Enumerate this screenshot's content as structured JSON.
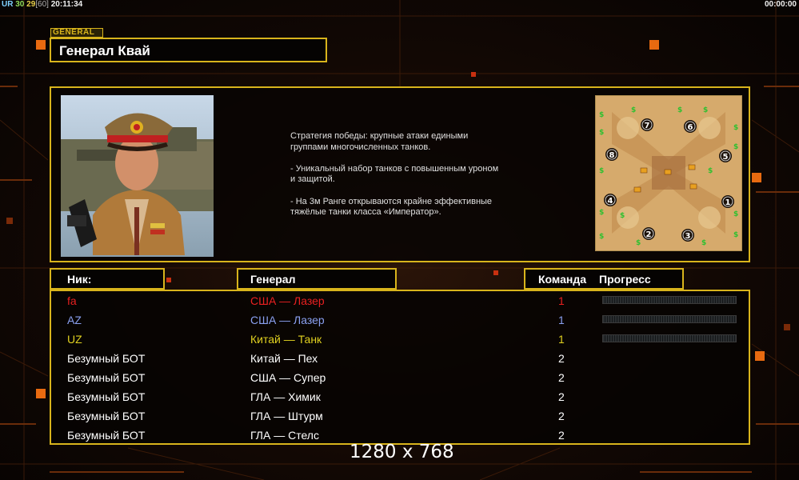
{
  "topbar": {
    "ur": "UR",
    "n1": "30",
    "n2": "29",
    "fps": "[60]",
    "clock": "20:11:34",
    "timer": "00:00:00"
  },
  "general_tag": "GENERAL",
  "general_name": "Генерал Квай",
  "description": "Стратегия победы: крупные атаки едиными\n группами многочисленных танков.\n\n- Уникальный набор танков с повышенным уроном\n и защитой.\n\n- На 3м Ранге открываются крайне эффективные\n тяжёлые танки класса «Император».",
  "minimap": {
    "spawn_numbers": [
      "7",
      "6",
      "8",
      "5",
      "4",
      "1",
      "2",
      "3"
    ]
  },
  "headers": {
    "nick": "Ник:",
    "general": "Генерал",
    "team": "Команда",
    "progress": "Прогресс"
  },
  "players": [
    {
      "nick": "fa",
      "general": "США — Лазер",
      "team": "1",
      "color": "#e82020",
      "progress": 0
    },
    {
      "nick": "AZ",
      "general": "США — Лазер",
      "team": "1",
      "color": "#8aa0f0",
      "progress": 0
    },
    {
      "nick": "UZ",
      "general": "Китай — Танк",
      "team": "1",
      "color": "#e0d020",
      "progress": 0
    },
    {
      "nick": "Безумный БОТ",
      "general": "Китай — Пех",
      "team": "2",
      "color": "#ffffff"
    },
    {
      "nick": "Безумный БОТ",
      "general": "США — Супер",
      "team": "2",
      "color": "#ffffff"
    },
    {
      "nick": "Безумный БОТ",
      "general": "ГЛА — Химик",
      "team": "2",
      "color": "#ffffff"
    },
    {
      "nick": "Безумный БОТ",
      "general": "ГЛА — Штурм",
      "team": "2",
      "color": "#ffffff"
    },
    {
      "nick": "Безумный БОТ",
      "general": "ГЛА — Стелс",
      "team": "2",
      "color": "#ffffff"
    }
  ],
  "resolution": "1280 x 768",
  "colors": {
    "accent": "#d8b41c",
    "highlight": "#e86a10"
  }
}
